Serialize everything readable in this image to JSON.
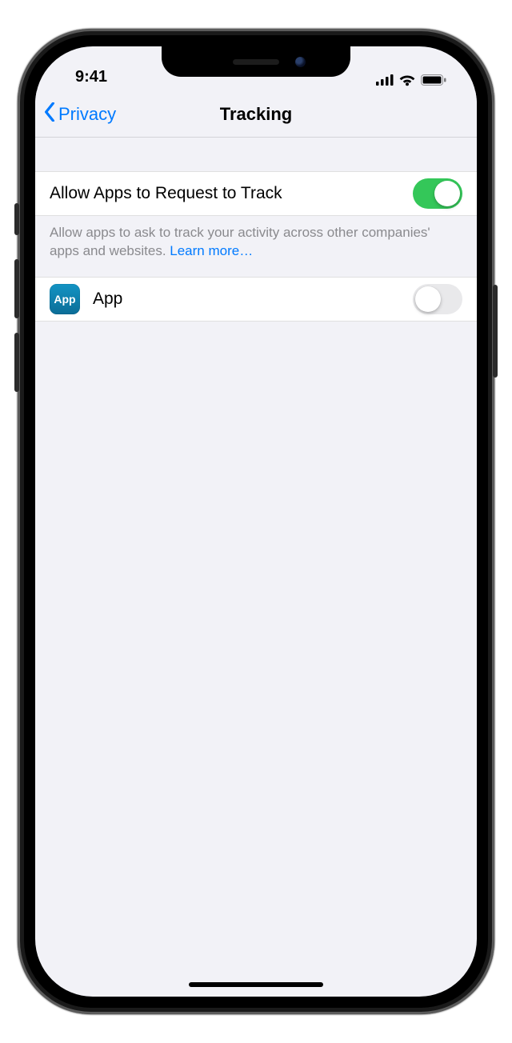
{
  "status": {
    "time": "9:41"
  },
  "nav": {
    "back_label": "Privacy",
    "title": "Tracking"
  },
  "allow_cell": {
    "label": "Allow Apps to Request to Track",
    "toggle_on": true
  },
  "allow_footer": {
    "text": "Allow apps to ask to track your activity across other companies' apps and websites. ",
    "link": "Learn more…"
  },
  "apps": [
    {
      "icon_label": "App",
      "name": "App",
      "toggle_on": false
    }
  ]
}
